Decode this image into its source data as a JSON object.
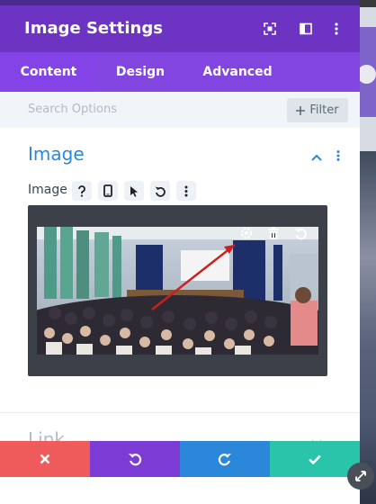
{
  "header": {
    "title": "Image Settings"
  },
  "tabs": [
    {
      "label": "Content",
      "active": true
    },
    {
      "label": "Design",
      "active": false
    },
    {
      "label": "Advanced",
      "active": false
    }
  ],
  "search": {
    "placeholder": "Search Options",
    "filter_label": "Filter"
  },
  "image_section": {
    "title": "Image",
    "field_label": "Image",
    "field_icons": [
      "help-icon",
      "mobile-icon",
      "pointer-icon",
      "reset-icon",
      "more-icon"
    ],
    "overlay_icons": [
      "settings-icon",
      "delete-icon",
      "undo-icon"
    ]
  },
  "link_section": {
    "title": "Link"
  },
  "footer": {
    "buttons": [
      {
        "name": "cancel",
        "color": "#ef5a5a"
      },
      {
        "name": "undo",
        "color": "#7d3bd6"
      },
      {
        "name": "redo",
        "color": "#2b87da"
      },
      {
        "name": "save",
        "color": "#29c4a9"
      }
    ]
  },
  "colors": {
    "header": "#6d33c3",
    "tabs": "#8245e0",
    "accent": "#2b87da"
  }
}
